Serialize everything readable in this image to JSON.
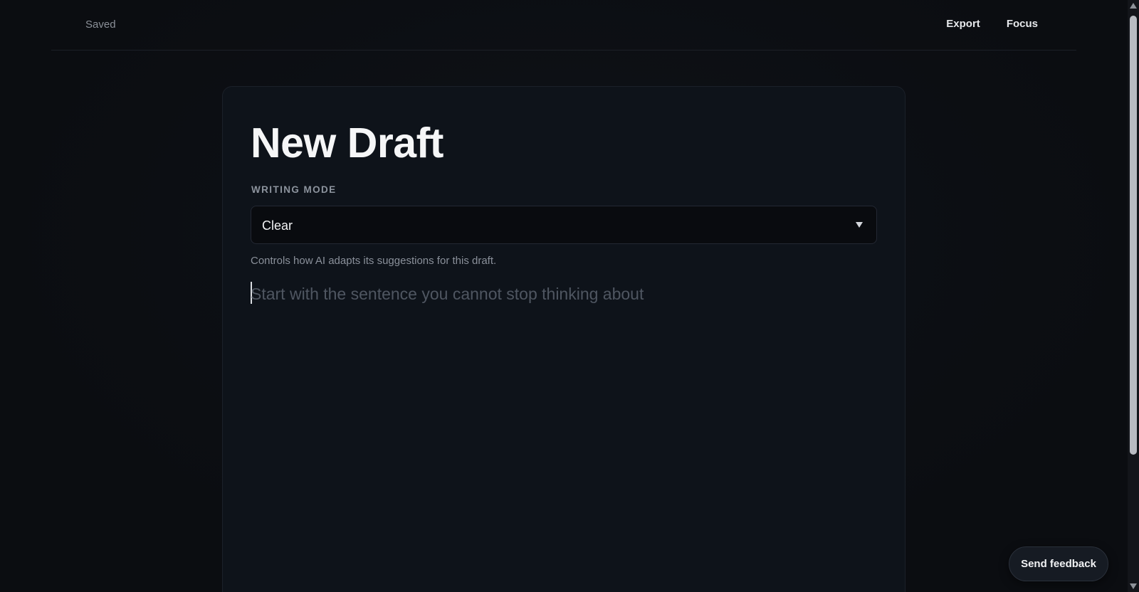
{
  "header": {
    "status": "Saved",
    "export_label": "Export",
    "focus_label": "Focus"
  },
  "draft": {
    "title": "New Draft",
    "writing_mode": {
      "label": "WRITING MODE",
      "selected": "Clear",
      "help": "Controls how AI adapts its suggestions for this draft."
    },
    "editor": {
      "placeholder": "Start with the sentence you cannot stop thinking about"
    }
  },
  "feedback": {
    "label": "Send feedback"
  },
  "icons": {
    "select_caret": "chevron-down-icon",
    "scroll_up": "arrow-up-icon",
    "scroll_down": "arrow-down-icon"
  },
  "colors": {
    "background": "#0b0d11",
    "card": "#0e131a",
    "text_primary": "#f5f6f7",
    "text_muted": "#8a909a",
    "placeholder": "#4f5661"
  }
}
